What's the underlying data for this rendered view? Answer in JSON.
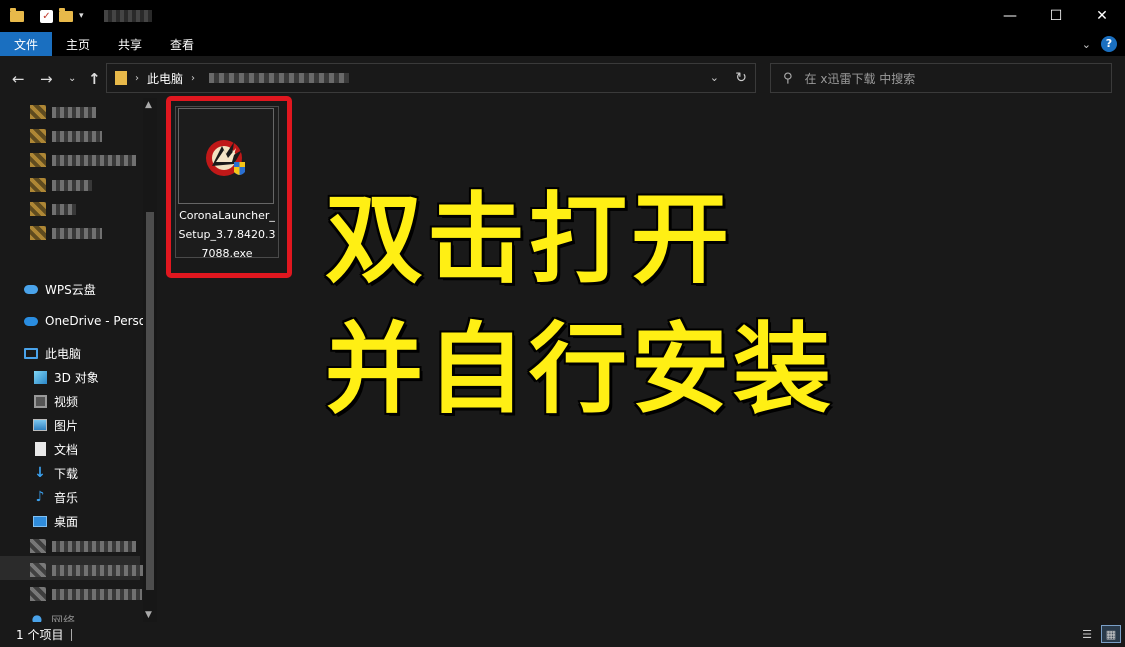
{
  "ribbon": {
    "tabs": [
      "文件",
      "主页",
      "共享",
      "查看"
    ],
    "help_icon": "?"
  },
  "address": {
    "root": "此电脑"
  },
  "search": {
    "placeholder": "在 x迅雷下载 中搜索"
  },
  "sidebar": {
    "items": [
      {
        "label": "WPS云盘",
        "icon": "cloud-icon"
      },
      {
        "label": "OneDrive - Perso",
        "icon": "onedrive-icon"
      },
      {
        "label": "此电脑",
        "icon": "computer-icon"
      },
      {
        "label": "3D 对象",
        "icon": "cube-icon"
      },
      {
        "label": "视频",
        "icon": "video-icon"
      },
      {
        "label": "图片",
        "icon": "pictures-icon"
      },
      {
        "label": "文档",
        "icon": "documents-icon"
      },
      {
        "label": "下载",
        "icon": "download-icon"
      },
      {
        "label": "音乐",
        "icon": "music-icon"
      },
      {
        "label": "桌面",
        "icon": "desktop-icon"
      },
      {
        "label": "网络",
        "icon": "network-icon"
      }
    ]
  },
  "file": {
    "name": "CoronaLauncher_Setup_3.7.8420.37088.exe",
    "icon": "corona-launcher-icon"
  },
  "overlay": {
    "line1": "双击打开",
    "line2": "并自行安装",
    "color": "#ffef14"
  },
  "status": {
    "count": "1 个项目"
  },
  "colors": {
    "accent": "#1a6fc0",
    "highlight": "#e0171f"
  }
}
